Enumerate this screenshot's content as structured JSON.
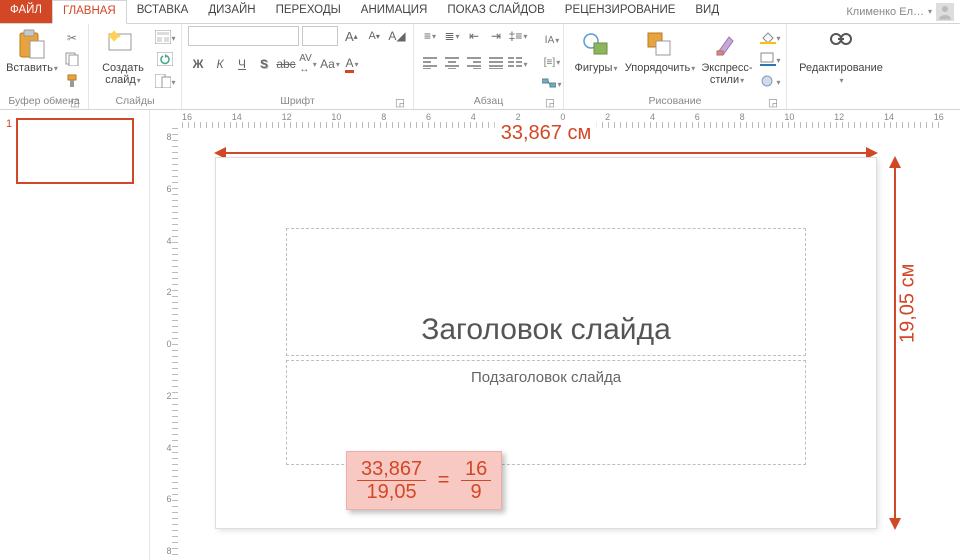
{
  "tabs": {
    "file": "ФАЙЛ",
    "items": [
      "ГЛАВНАЯ",
      "ВСТАВКА",
      "ДИЗАЙН",
      "ПЕРЕХОДЫ",
      "АНИМАЦИЯ",
      "ПОКАЗ СЛАЙДОВ",
      "РЕЦЕНЗИРОВАНИЕ",
      "ВИД"
    ],
    "active_index": 0,
    "user": "Клименко Ел…"
  },
  "ribbon": {
    "clipboard": {
      "paste": "Вставить",
      "label": "Буфер обмена"
    },
    "slides": {
      "new_slide": "Создать слайд",
      "label": "Слайды"
    },
    "font": {
      "label": "Шрифт"
    },
    "paragraph": {
      "label": "Абзац"
    },
    "drawing": {
      "shapes": "Фигуры",
      "arrange": "Упорядочить",
      "quick_styles_line1": "Экспресс-",
      "quick_styles_line2": "стили",
      "label": "Рисование"
    },
    "editing": {
      "edit": "Редактирование",
      "label": ""
    }
  },
  "ruler_h": [
    "16",
    "14",
    "12",
    "10",
    "8",
    "6",
    "4",
    "2",
    "0",
    "2",
    "4",
    "6",
    "8",
    "10",
    "12",
    "14",
    "16"
  ],
  "ruler_v": [
    "8",
    "6",
    "4",
    "2",
    "0",
    "2",
    "4",
    "6",
    "8"
  ],
  "thumb": {
    "number": "1"
  },
  "slide": {
    "title_placeholder": "Заголовок слайда",
    "subtitle_placeholder": "Подзаголовок слайда",
    "width_label": "33,867 см",
    "height_label": "19,05 см"
  },
  "formula": {
    "a_num": "33,867",
    "a_den": "19,05",
    "b_num": "16",
    "b_den": "9"
  }
}
